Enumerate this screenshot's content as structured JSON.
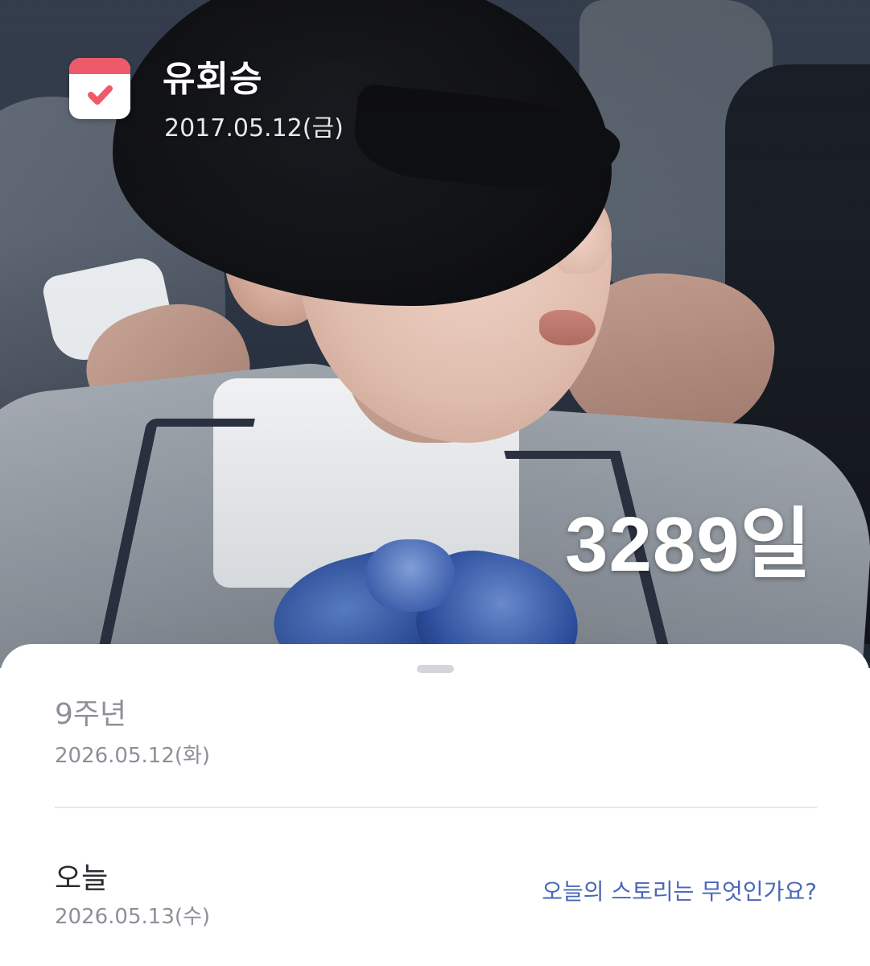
{
  "header": {
    "app_icon": "calendar-check-icon",
    "event_name": "유회승",
    "event_date": "2017.05.12(금)"
  },
  "counter": {
    "days_label": "3289일"
  },
  "sheet": {
    "milestone": {
      "title": "9주년",
      "date": "2026.05.12(화)"
    },
    "today": {
      "title": "오늘",
      "date": "2026.05.13(수)",
      "story_prompt": "오늘의 스토리는 무엇인가요?"
    }
  },
  "colors": {
    "icon_accent": "#ef5a6a",
    "link": "#4a67b8",
    "muted_text": "#8d9098"
  }
}
